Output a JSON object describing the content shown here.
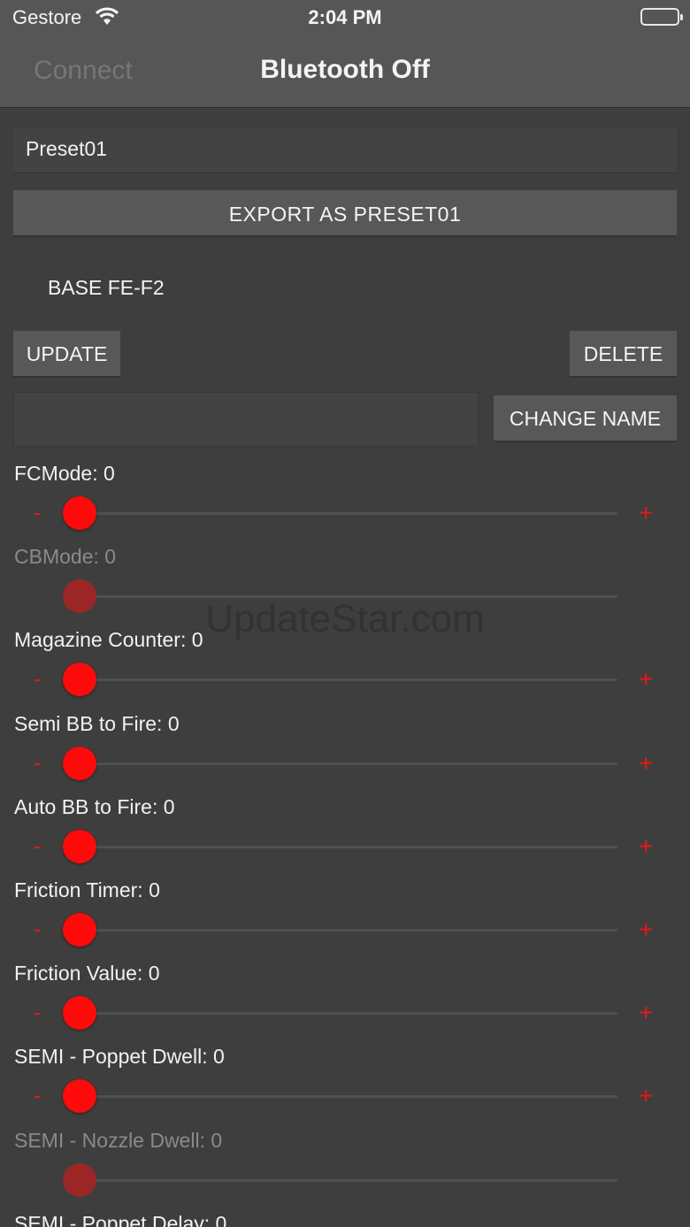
{
  "status_bar": {
    "carrier": "Gestore",
    "time": "2:04 PM"
  },
  "nav": {
    "left_button": "Connect",
    "title": "Bluetooth Off"
  },
  "preset_name": "Preset01",
  "export_label": "EXPORT AS PRESET01",
  "base_label": "BASE FE-F2",
  "update_label": "UPDATE",
  "delete_label": "DELETE",
  "name_input": {
    "value": "",
    "placeholder": ""
  },
  "change_name_label": "CHANGE NAME",
  "controls": {
    "minus": "-",
    "plus": "+"
  },
  "params": [
    {
      "label": "FCMode: 0",
      "value": 0,
      "enabled": true
    },
    {
      "label": "CBMode: 0",
      "value": 0,
      "enabled": false
    },
    {
      "label": "Magazine Counter: 0",
      "value": 0,
      "enabled": true
    },
    {
      "label": "Semi BB to Fire: 0",
      "value": 0,
      "enabled": true
    },
    {
      "label": "Auto BB to Fire: 0",
      "value": 0,
      "enabled": true
    },
    {
      "label": "Friction Timer: 0",
      "value": 0,
      "enabled": true
    },
    {
      "label": "Friction Value: 0",
      "value": 0,
      "enabled": true
    },
    {
      "label": "SEMI - Poppet Dwell: 0",
      "value": 0,
      "enabled": true
    },
    {
      "label": "SEMI - Nozzle Dwell: 0",
      "value": 0,
      "enabled": false
    },
    {
      "label": "SEMI - Poppet Delay: 0",
      "value": 0,
      "enabled": true
    }
  ],
  "watermark": "UpdateStar.com",
  "colors": {
    "accent": "#ff0a0a",
    "background": "#3e3e3e",
    "button": "#585858"
  }
}
